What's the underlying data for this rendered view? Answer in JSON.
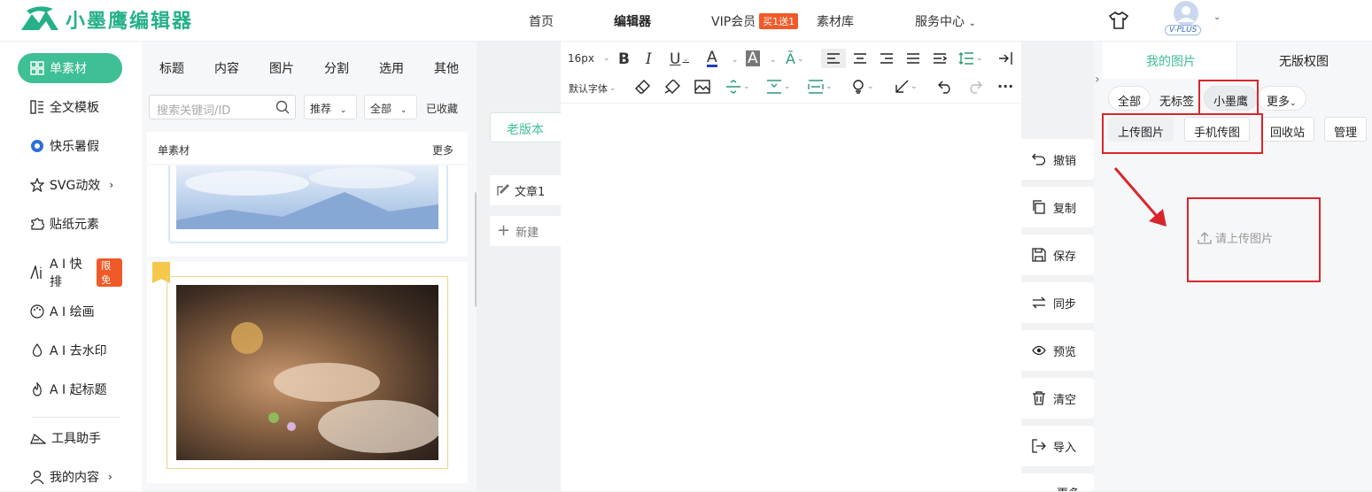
{
  "header": {
    "logo_text": "小墨鹰编辑器",
    "nav": [
      "首页",
      "编辑器",
      "VIP会员",
      "素材库",
      "服务中心"
    ],
    "vip_badge": "买1送1",
    "user_badge": "V-PLUS"
  },
  "sidebar": {
    "items": [
      {
        "label": "单素材"
      },
      {
        "label": "全文模板"
      },
      {
        "label": "快乐暑假"
      },
      {
        "label": "SVG动效"
      },
      {
        "label": "贴纸元素"
      },
      {
        "label": "A I 快排",
        "badge": "限免"
      },
      {
        "label": "A I 绘画"
      },
      {
        "label": "A I 去水印"
      },
      {
        "label": "A I 起标题"
      },
      {
        "label": "工具助手"
      },
      {
        "label": "我的内容"
      }
    ]
  },
  "material": {
    "tabs": [
      "标题",
      "内容",
      "图片",
      "分割",
      "选用",
      "其他"
    ],
    "search_placeholder": "搜索关键词/ID",
    "filter_sort": "推荐",
    "filter_scope": "全部",
    "favorites": "已收藏",
    "section_title": "单素材",
    "more": "更多"
  },
  "editor": {
    "old_version": "老版本",
    "article": "文章1",
    "new_article": "新建",
    "font_size": "16px",
    "font_family": "默认字体"
  },
  "actions": [
    "撤销",
    "复制",
    "保存",
    "同步",
    "预览",
    "清空",
    "导入",
    "更多"
  ],
  "right": {
    "tabs": [
      "我的图片",
      "无版权图"
    ],
    "chips": [
      "全部",
      "无标签",
      "小墨鹰",
      "更多"
    ],
    "buttons": [
      "上传图片",
      "手机传图",
      "回收站",
      "管理"
    ],
    "empty_hint": "请上传图片"
  },
  "colors": {
    "brand": "#3fbf95",
    "highlight": "#d9262c",
    "badge": "#f05a28"
  }
}
